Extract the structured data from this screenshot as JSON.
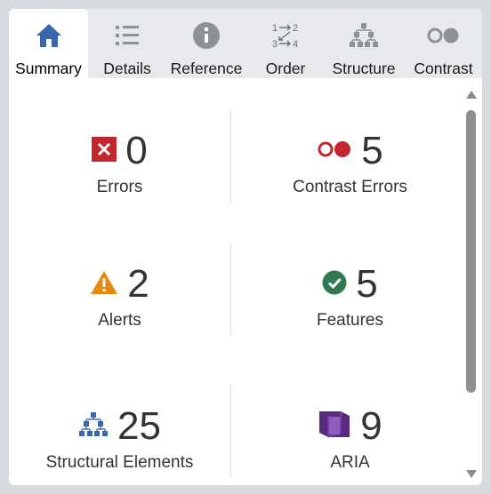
{
  "tabs": [
    {
      "label": "Summary",
      "icon": "home-icon",
      "active": true
    },
    {
      "label": "Details",
      "icon": "list-icon"
    },
    {
      "label": "Reference",
      "icon": "info-icon"
    },
    {
      "label": "Order",
      "icon": "order-icon"
    },
    {
      "label": "Structure",
      "icon": "hierarchy-icon"
    },
    {
      "label": "Contrast",
      "icon": "contrast-icon"
    }
  ],
  "summary": {
    "errors": {
      "count": "0",
      "label": "Errors",
      "icon": "error-icon",
      "color": "#c1272d"
    },
    "contrast_errors": {
      "count": "5",
      "label": "Contrast Errors",
      "icon": "contrast-error-icon",
      "color": "#c1272d"
    },
    "alerts": {
      "count": "2",
      "label": "Alerts",
      "icon": "alert-icon",
      "color": "#e38a12"
    },
    "features": {
      "count": "5",
      "label": "Features",
      "icon": "feature-icon",
      "color": "#2f7a50"
    },
    "structural": {
      "count": "25",
      "label": "Structural Elements",
      "icon": "structure-icon",
      "color": "#3a66b0"
    },
    "aria": {
      "count": "9",
      "label": "ARIA",
      "icon": "aria-icon",
      "color": "#5a2a82"
    }
  }
}
